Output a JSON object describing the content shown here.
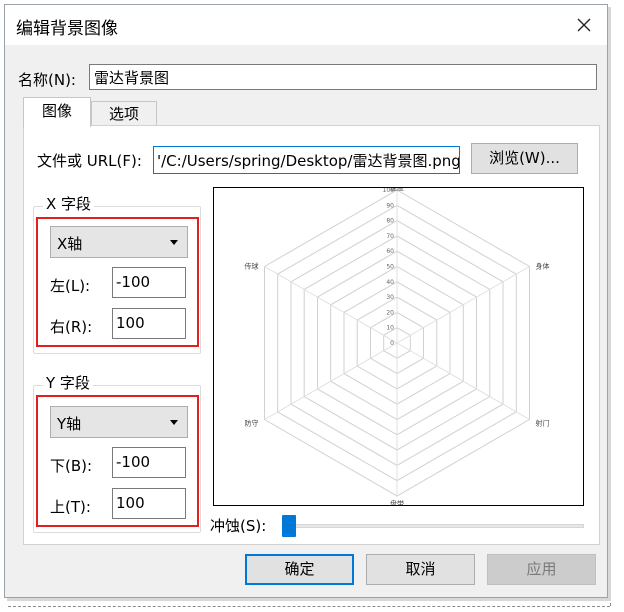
{
  "window": {
    "title": "编辑背景图像"
  },
  "name_field": {
    "label": "名称(N):",
    "value": "雷达背景图"
  },
  "tabs": [
    {
      "label": "图像",
      "active": true
    },
    {
      "label": "选项",
      "active": false
    }
  ],
  "file": {
    "label": "文件或 URL(F):",
    "value": "'/C:/Users/spring/Desktop/雷达背景图.png",
    "browse_label": "浏览(W)..."
  },
  "x_field": {
    "group_label": "X 字段",
    "axis_selected": "X轴",
    "left_label": "左(L):",
    "left_value": "-100",
    "right_label": "右(R):",
    "right_value": "100"
  },
  "y_field": {
    "group_label": "Y 字段",
    "axis_selected": "Y轴",
    "bottom_label": "下(B):",
    "bottom_value": "-100",
    "top_label": "上(T):",
    "top_value": "100"
  },
  "preview": {
    "axes": [
      "速度",
      "身体",
      "射门",
      "盘带",
      "防守",
      "传球"
    ],
    "rings": [
      "0",
      "10",
      "20",
      "30",
      "40",
      "50",
      "60",
      "70",
      "80",
      "90",
      "100"
    ]
  },
  "erosion": {
    "label": "冲蚀(S):",
    "value": 0
  },
  "buttons": {
    "ok": "确定",
    "cancel": "取消",
    "apply": "应用"
  },
  "colors": {
    "accent": "#0078d7",
    "highlight": "#e02020"
  }
}
